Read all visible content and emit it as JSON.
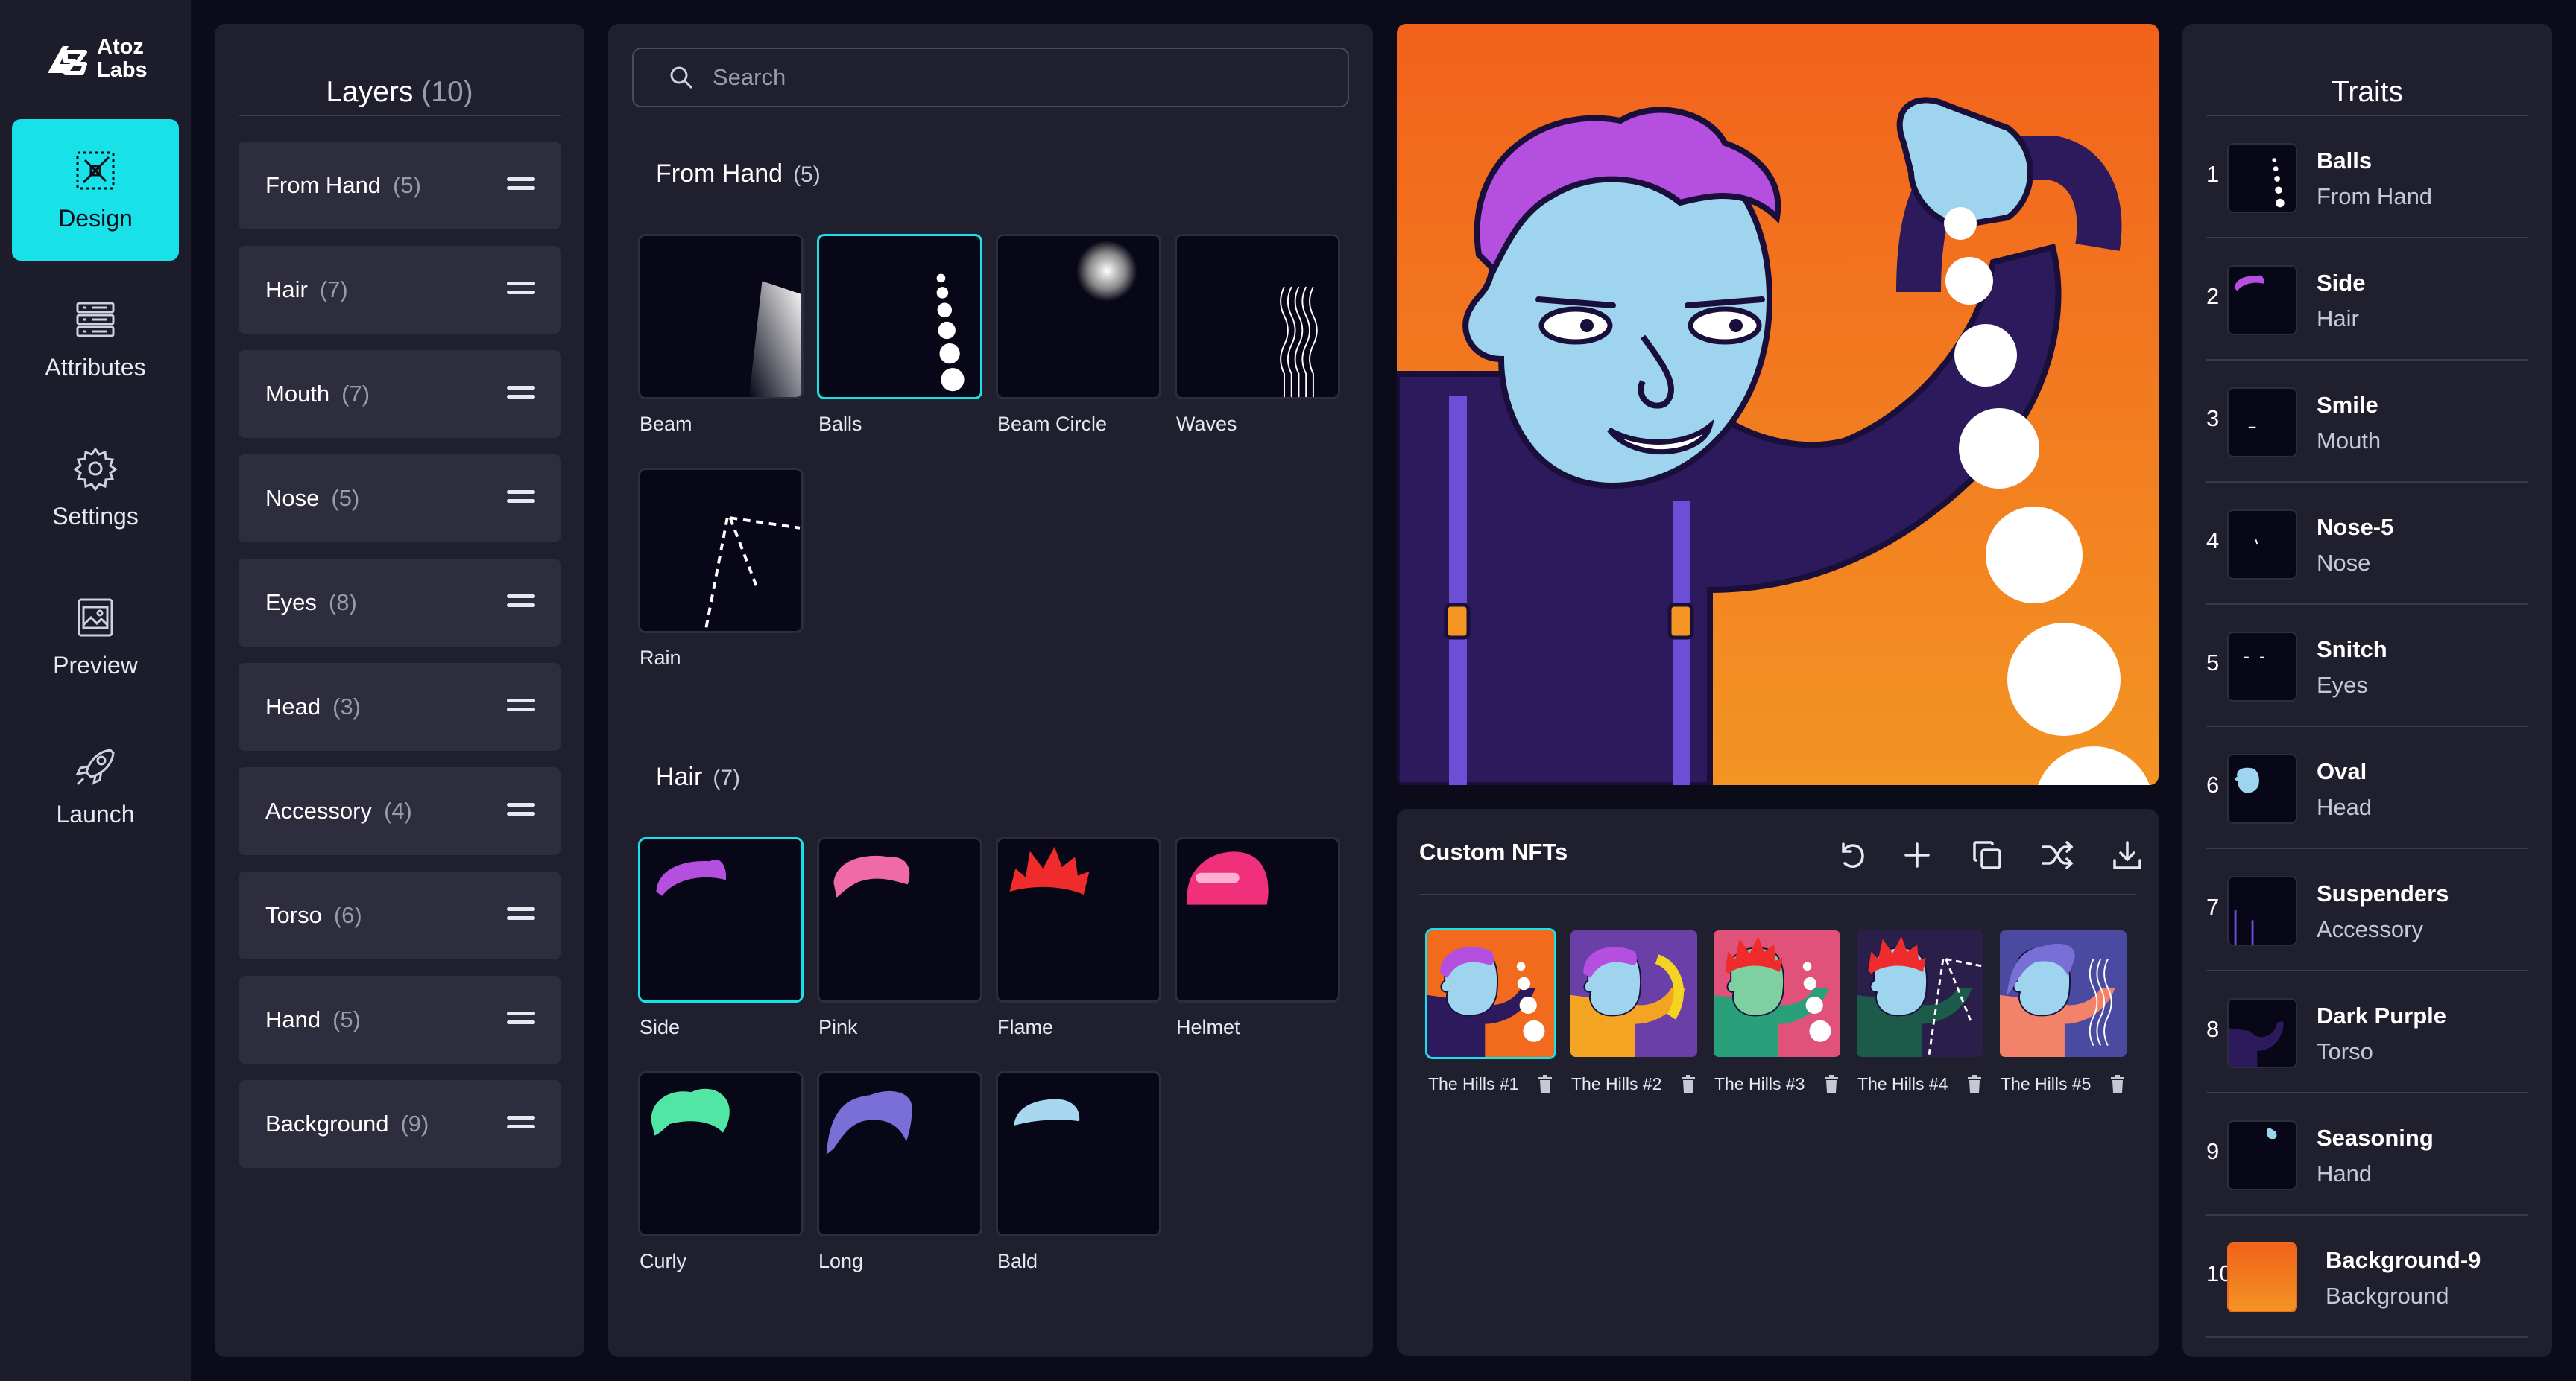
{
  "brand": {
    "name_line1": "Atoz",
    "name_line2": "Labs"
  },
  "nav": {
    "items": [
      {
        "label": "Design",
        "icon": "design-icon",
        "active": true
      },
      {
        "label": "Attributes",
        "icon": "attributes-icon",
        "active": false
      },
      {
        "label": "Settings",
        "icon": "gear-icon",
        "active": false
      },
      {
        "label": "Preview",
        "icon": "image-icon",
        "active": false
      },
      {
        "label": "Launch",
        "icon": "rocket-icon",
        "active": false
      }
    ]
  },
  "layers": {
    "title": "Layers",
    "count": "(10)",
    "items": [
      {
        "label": "From Hand",
        "count": "(5)"
      },
      {
        "label": "Hair",
        "count": "(7)"
      },
      {
        "label": "Mouth",
        "count": "(7)"
      },
      {
        "label": "Nose",
        "count": "(5)"
      },
      {
        "label": "Eyes",
        "count": "(8)"
      },
      {
        "label": "Head",
        "count": "(3)"
      },
      {
        "label": "Accessory",
        "count": "(4)"
      },
      {
        "label": "Torso",
        "count": "(6)"
      },
      {
        "label": "Hand",
        "count": "(5)"
      },
      {
        "label": "Background",
        "count": "(9)"
      }
    ]
  },
  "search": {
    "placeholder": "Search"
  },
  "sections": [
    {
      "title": "From Hand",
      "count": "(5)",
      "items": [
        {
          "label": "Beam",
          "selected": false
        },
        {
          "label": "Balls",
          "selected": true
        },
        {
          "label": "Beam Circle",
          "selected": false
        },
        {
          "label": "Waves",
          "selected": false
        },
        {
          "label": "Rain",
          "selected": false
        }
      ]
    },
    {
      "title": "Hair",
      "count": "(7)",
      "items": [
        {
          "label": "Side",
          "selected": true,
          "color": "#b44fe0"
        },
        {
          "label": "Pink",
          "selected": false,
          "color": "#f06aa8"
        },
        {
          "label": "Flame",
          "selected": false,
          "color": "#ef2b2b"
        },
        {
          "label": "Helmet",
          "selected": false,
          "color": "#f0307a"
        },
        {
          "label": "Curly",
          "selected": false,
          "color": "#52e6a4"
        },
        {
          "label": "Long",
          "selected": false,
          "color": "#7a6fd6"
        },
        {
          "label": "Bald",
          "selected": false,
          "color": "#a8d8f0"
        }
      ]
    }
  ],
  "custom": {
    "title": "Custom NFTs",
    "tools": [
      "undo-icon",
      "plus-icon",
      "copy-icon",
      "shuffle-icon",
      "download-icon"
    ],
    "nfts": [
      {
        "label": "The Hills #1",
        "bg": "#f26a1e",
        "hair": "#b44fe0",
        "selected": true
      },
      {
        "label": "The Hills #2",
        "bg": "#6b3fa8",
        "hair": "#b44fe0",
        "selected": false
      },
      {
        "label": "The Hills #3",
        "bg": "#e0527a",
        "hair": "#ef2b2b",
        "selected": false
      },
      {
        "label": "The Hills #4",
        "bg": "#2a1f4a",
        "hair": "#ef2b2b",
        "selected": false
      },
      {
        "label": "The Hills #5",
        "bg": "#4a4aa0",
        "hair": "#7a6fd6",
        "selected": false
      }
    ]
  },
  "traits": {
    "title": "Traits",
    "items": [
      {
        "num": "1",
        "name": "Balls",
        "layer": "From Hand"
      },
      {
        "num": "2",
        "name": "Side",
        "layer": "Hair"
      },
      {
        "num": "3",
        "name": "Smile",
        "layer": "Mouth"
      },
      {
        "num": "4",
        "name": "Nose-5",
        "layer": "Nose"
      },
      {
        "num": "5",
        "name": "Snitch",
        "layer": "Eyes"
      },
      {
        "num": "6",
        "name": "Oval",
        "layer": "Head"
      },
      {
        "num": "7",
        "name": "Suspenders",
        "layer": "Accessory"
      },
      {
        "num": "8",
        "name": "Dark Purple",
        "layer": "Torso"
      },
      {
        "num": "9",
        "name": "Seasoning",
        "layer": "Hand"
      },
      {
        "num": "10",
        "name": "Background-9",
        "layer": "Background"
      }
    ]
  },
  "colors": {
    "accent": "#19e1e8",
    "panel": "#1f1f2e",
    "background": "#0b0b1a"
  }
}
